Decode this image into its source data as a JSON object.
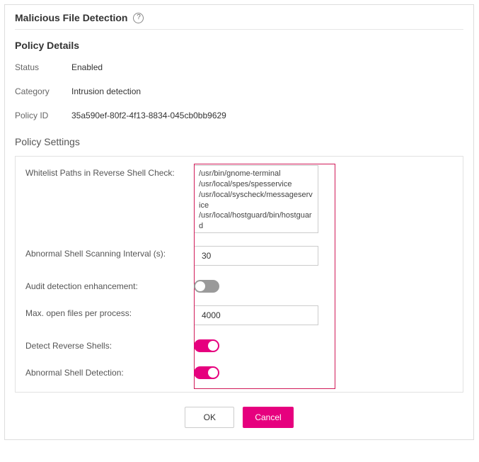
{
  "title": "Malicious File Detection",
  "sections": {
    "details_title": "Policy Details",
    "settings_title": "Policy Settings"
  },
  "details": {
    "status_label": "Status",
    "status_value": "Enabled",
    "category_label": "Category",
    "category_value": "Intrusion detection",
    "policyid_label": "Policy ID",
    "policyid_value": "35a590ef-80f2-4f13-8834-045cb0bb9629"
  },
  "settings": {
    "whitelist_label": "Whitelist Paths in Reverse Shell Check:",
    "whitelist_value": "/usr/bin/gnome-terminal\n/usr/local/spes/spesservice\n/usr/local/syscheck/messageservice\n/usr/local/hostguard/bin/hostguard\n/usr/bin/uvp-monitor",
    "interval_label": "Abnormal Shell Scanning Interval (s):",
    "interval_value": "30",
    "audit_label": "Audit detection enhancement:",
    "audit_on": false,
    "maxfiles_label": "Max. open files per process:",
    "maxfiles_value": "4000",
    "reverse_label": "Detect Reverse Shells:",
    "reverse_on": true,
    "abnormal_label": "Abnormal Shell Detection:",
    "abnormal_on": true
  },
  "buttons": {
    "ok": "OK",
    "cancel": "Cancel"
  },
  "chart_data": null
}
